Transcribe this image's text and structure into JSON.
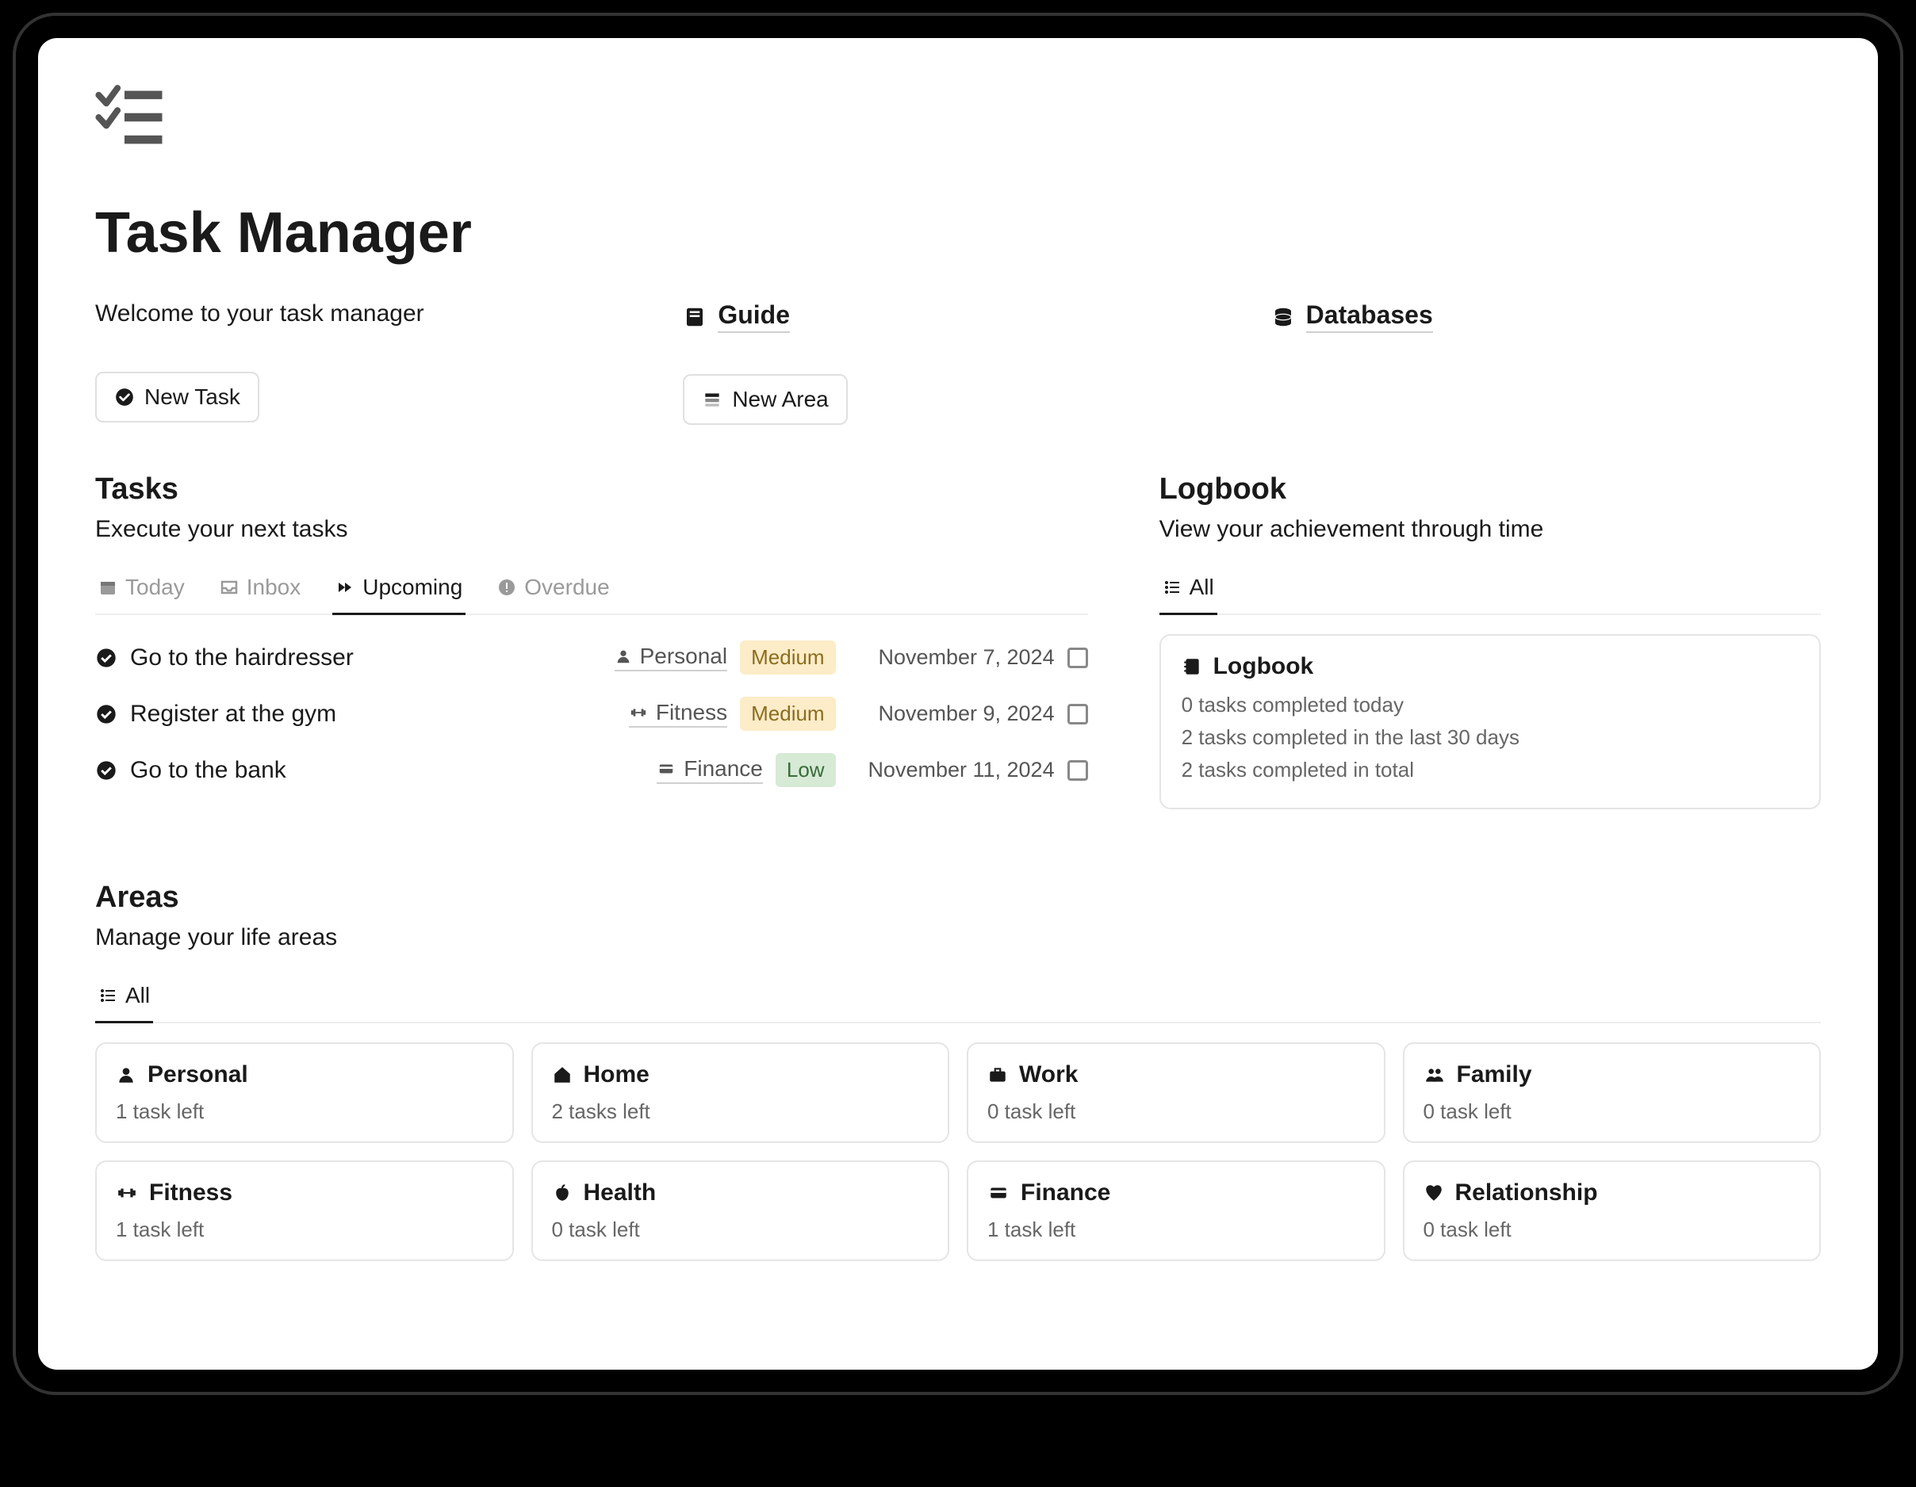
{
  "page": {
    "title": "Task Manager",
    "welcome": "Welcome to your task manager"
  },
  "links": {
    "guide": "Guide",
    "databases": "Databases"
  },
  "buttons": {
    "new_task": "New Task",
    "new_area": "New Area"
  },
  "tasks": {
    "heading": "Tasks",
    "subheading": "Execute your next tasks",
    "tabs": {
      "today": "Today",
      "inbox": "Inbox",
      "upcoming": "Upcoming",
      "overdue": "Overdue"
    },
    "items": [
      {
        "title": "Go to the hairdresser",
        "area": "Personal",
        "priority": "Medium",
        "priority_class": "pill-medium",
        "date": "November 7, 2024"
      },
      {
        "title": "Register at the gym",
        "area": "Fitness",
        "priority": "Medium",
        "priority_class": "pill-medium",
        "date": "November 9, 2024"
      },
      {
        "title": "Go to the bank",
        "area": "Finance",
        "priority": "Low",
        "priority_class": "pill-low",
        "date": "November 11, 2024"
      }
    ]
  },
  "logbook": {
    "heading": "Logbook",
    "subheading": "View your achievement through time",
    "tab_all": "All",
    "card_title": "Logbook",
    "lines": [
      "0 tasks completed today",
      "2 tasks completed in the last 30 days",
      "2 tasks completed in total"
    ]
  },
  "areas": {
    "heading": "Areas",
    "subheading": "Manage your life areas",
    "tab_all": "All",
    "items": [
      {
        "name": "Personal",
        "sub": "1 task left",
        "icon": "person"
      },
      {
        "name": "Home",
        "sub": "2 tasks left",
        "icon": "home"
      },
      {
        "name": "Work",
        "sub": "0 task left",
        "icon": "briefcase"
      },
      {
        "name": "Family",
        "sub": "0 task left",
        "icon": "group"
      },
      {
        "name": "Fitness",
        "sub": "1 task left",
        "icon": "dumbbell"
      },
      {
        "name": "Health",
        "sub": "0 task left",
        "icon": "apple"
      },
      {
        "name": "Finance",
        "sub": "1 task left",
        "icon": "card"
      },
      {
        "name": "Relationship",
        "sub": "0 task left",
        "icon": "heart"
      }
    ]
  }
}
